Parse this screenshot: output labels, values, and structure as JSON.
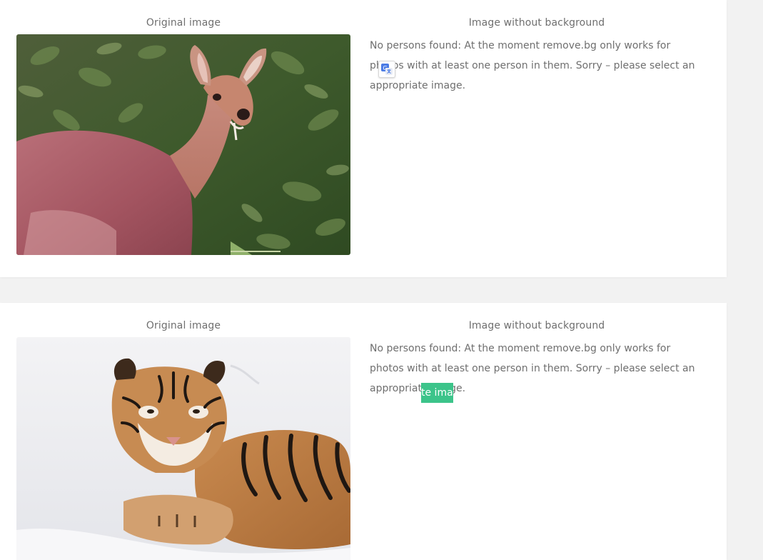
{
  "results": [
    {
      "original_title": "Original image",
      "no_bg_title": "Image without background",
      "message": "No persons found: At the moment remove.bg only works for photos with at least one person in them. Sorry – please select an appropriate image.",
      "subject": "deer"
    },
    {
      "original_title": "Original image",
      "no_bg_title": "Image without background",
      "message": "No persons found: At the moment remove.bg only works for photos with at least one person in them. Sorry – please select an appropriate image.",
      "subject": "tiger-cub",
      "highlight_text": "te imag"
    }
  ],
  "colors": {
    "page_bg": "#f2f2f2",
    "card_bg": "#ffffff",
    "text": "#6f6f6f",
    "highlight": "#3cc48a",
    "translate_icon": "#4a7be5"
  },
  "icons": [
    "translate-icon"
  ]
}
